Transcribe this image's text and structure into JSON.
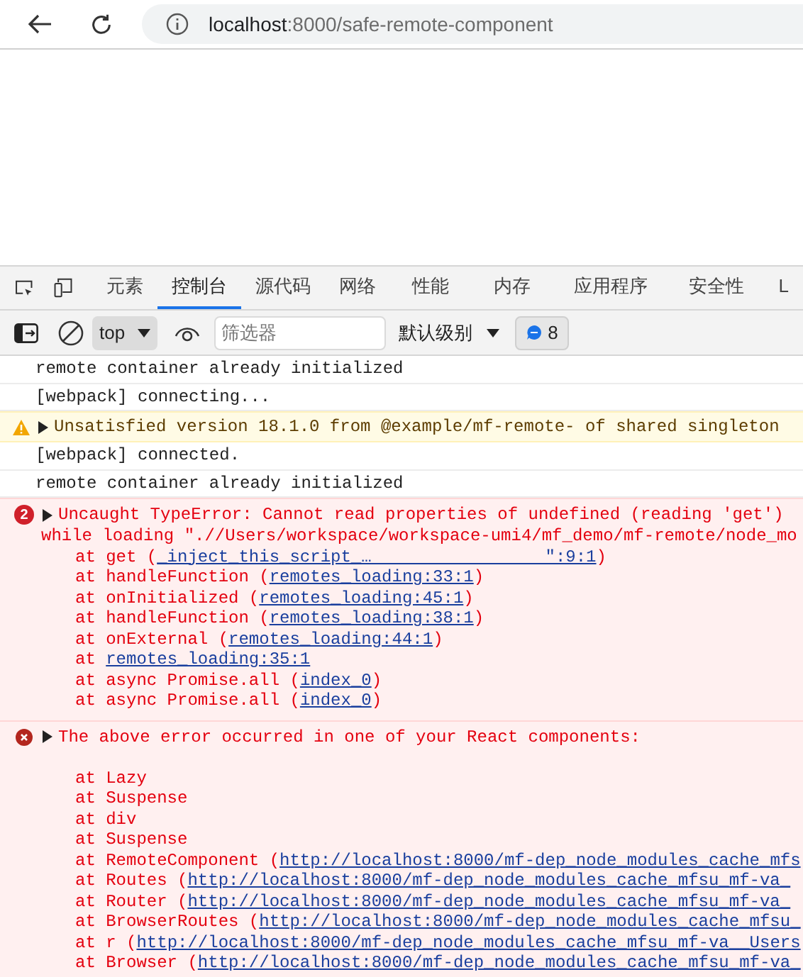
{
  "browser": {
    "url_host": "localhost",
    "url_path": ":8000/safe-remote-component"
  },
  "devtools": {
    "tabs": [
      {
        "label": "元素",
        "selected": false
      },
      {
        "label": "控制台",
        "selected": true
      },
      {
        "label": "源代码",
        "selected": false
      },
      {
        "label": "网络",
        "selected": false
      },
      {
        "label": "性能",
        "selected": false
      },
      {
        "label": "内存",
        "selected": false
      },
      {
        "label": "应用程序",
        "selected": false
      },
      {
        "label": "安全性",
        "selected": false
      },
      {
        "label": "L",
        "selected": false
      }
    ],
    "toolbar": {
      "context": "top",
      "filter_placeholder": "筛选器",
      "level": "默认级别",
      "message_count": "8"
    },
    "console": [
      {
        "kind": "log",
        "text": "remote container already initialized"
      },
      {
        "kind": "log",
        "text": "[webpack] connecting..."
      },
      {
        "kind": "warning",
        "text": "Unsatisfied version 18.1.0 from @example/mf-remote- of shared singleton"
      },
      {
        "kind": "log",
        "text": "[webpack] connected."
      },
      {
        "kind": "log",
        "text": "remote container already initialized"
      },
      {
        "kind": "error",
        "count": "2",
        "text": "Uncaught TypeError: Cannot read properties of undefined (reading 'get')",
        "continuation": "while loading \".//Users/workspace/workspace-umi4/mf_demo/mf-remote/node_mo",
        "stack": [
          {
            "text": "at get (",
            "link": "_inject_this_script_…                 \":9:1",
            "suffix": ")"
          },
          {
            "text": "at handleFunction (",
            "link": "remotes_loading:33:1",
            "suffix": ")"
          },
          {
            "text": "at onInitialized (",
            "link": "remotes_loading:45:1",
            "suffix": ")"
          },
          {
            "text": "at handleFunction (",
            "link": "remotes_loading:38:1",
            "suffix": ")"
          },
          {
            "text": "at onExternal (",
            "link": "remotes_loading:44:1",
            "suffix": ")"
          },
          {
            "text": "at ",
            "link": "remotes_loading:35:1"
          },
          {
            "text": "at async Promise.all (",
            "link": "index_0",
            "suffix": ")"
          },
          {
            "text": "at async Promise.all (",
            "link": "index_0",
            "suffix": ")"
          }
        ]
      },
      {
        "kind": "error",
        "text": "The above error occurred in one of your React components:",
        "stack": [
          {
            "text": "at Lazy"
          },
          {
            "text": "at Suspense"
          },
          {
            "text": "at div"
          },
          {
            "text": "at Suspense"
          },
          {
            "text": "at RemoteComponent (",
            "link": "http://localhost:8000/mf-dep_node_modules_cache_mfs"
          },
          {
            "text": "at Routes (",
            "link": "http://localhost:8000/mf-dep_node_modules_cache_mfsu_mf-va_"
          },
          {
            "text": "at Router (",
            "link": "http://localhost:8000/mf-dep_node_modules_cache_mfsu_mf-va_"
          },
          {
            "text": "at BrowserRoutes (",
            "link": "http://localhost:8000/mf-dep_node_modules_cache_mfsu_"
          },
          {
            "text": "at r (",
            "link": "http://localhost:8000/mf-dep_node_modules_cache_mfsu_mf-va__Users"
          },
          {
            "text": "at Browser (",
            "link": "http://localhost:8000/mf-dep_node_modules_cache_mfsu_mf-va_"
          }
        ]
      }
    ]
  }
}
